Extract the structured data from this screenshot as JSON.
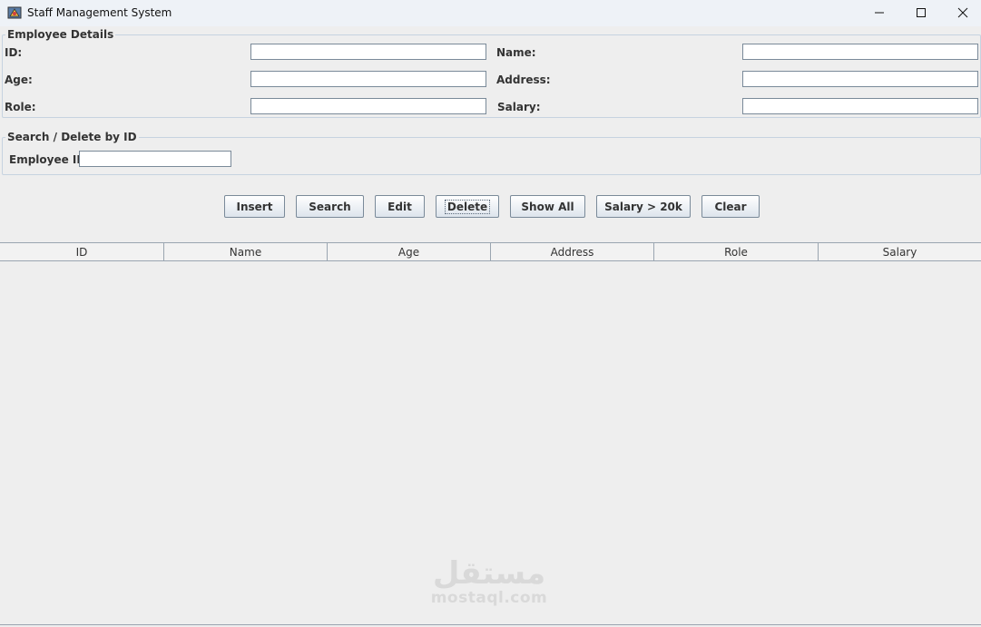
{
  "window": {
    "title": "Staff Management System"
  },
  "employee_details": {
    "legend": "Employee Details",
    "fields": {
      "id": {
        "label": "ID:",
        "value": ""
      },
      "name": {
        "label": "Name:",
        "value": ""
      },
      "age": {
        "label": "Age:",
        "value": ""
      },
      "address": {
        "label": "Address:",
        "value": ""
      },
      "role": {
        "label": "Role:",
        "value": ""
      },
      "salary": {
        "label": "Salary:",
        "value": ""
      }
    }
  },
  "search_delete": {
    "legend": "Search / Delete by ID",
    "employee_id": {
      "label": "Employee ID:",
      "value": ""
    }
  },
  "buttons": {
    "insert": "Insert",
    "search": "Search",
    "edit": "Edit",
    "delete": "Delete",
    "show_all": "Show All",
    "salary_gt_20k": "Salary > 20k",
    "clear": "Clear"
  },
  "table": {
    "columns": [
      "ID",
      "Name",
      "Age",
      "Address",
      "Role",
      "Salary"
    ],
    "rows": []
  },
  "watermark": {
    "arabic": "مستقل",
    "latin": "mostaql.com"
  }
}
